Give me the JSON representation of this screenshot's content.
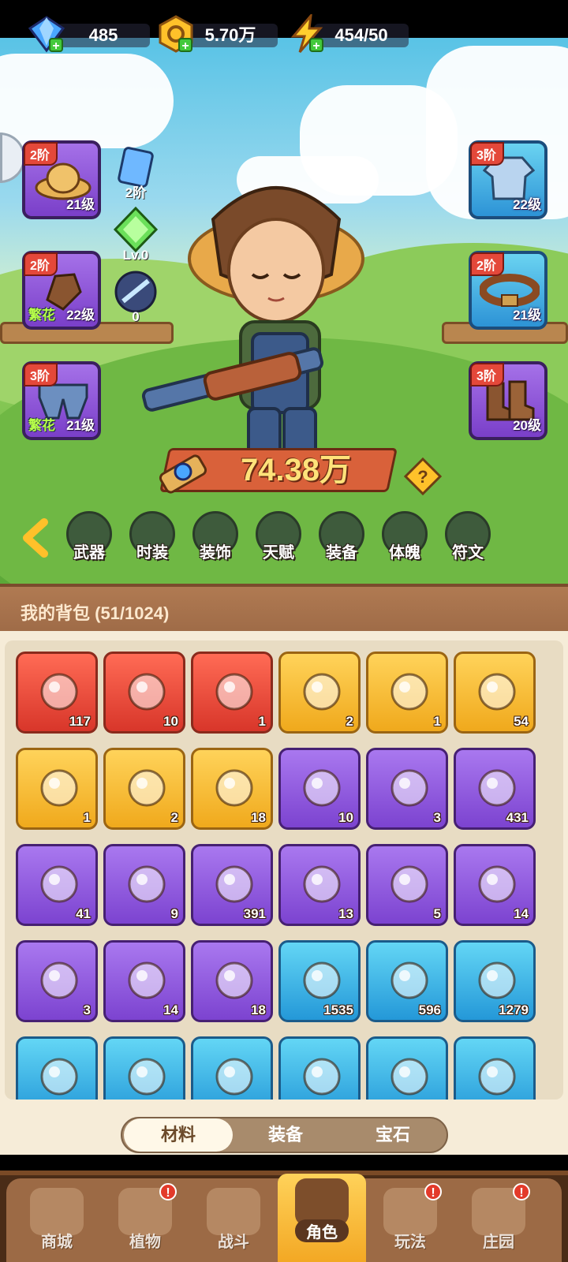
{
  "resources": {
    "gems": "485",
    "gold": "5.70万",
    "energy": "454/50"
  },
  "equip_left": [
    {
      "tier": "2阶",
      "level": "21级",
      "icon": "straw-hat-icon"
    },
    {
      "tier": "2阶",
      "level": "22级",
      "flower": "繁花",
      "icon": "glove-icon"
    },
    {
      "tier": "3阶",
      "level": "21级",
      "flower": "繁花",
      "icon": "pants-icon"
    }
  ],
  "equip_right": [
    {
      "tier": "3阶",
      "level": "22级",
      "icon": "shirt-icon"
    },
    {
      "tier": "2阶",
      "level": "21级",
      "icon": "belt-icon"
    },
    {
      "tier": "3阶",
      "level": "20级",
      "icon": "boots-icon"
    }
  ],
  "side_badges": {
    "card": "2阶",
    "gem": "Lv.0",
    "orb": "0"
  },
  "power": "74.38万",
  "menu": [
    "武器",
    "时装",
    "装饰",
    "天赋",
    "装备",
    "体魄",
    "符文"
  ],
  "bag": {
    "title": "我的背包 (51/1024)",
    "items": [
      {
        "rarity": "red",
        "count": "117",
        "icon": "crystal-star-icon"
      },
      {
        "rarity": "red",
        "count": "10",
        "icon": "red-potion-icon"
      },
      {
        "rarity": "red",
        "count": "1",
        "icon": "green-capsule-icon"
      },
      {
        "rarity": "gold",
        "count": "2",
        "icon": "golden-key-icon"
      },
      {
        "rarity": "gold",
        "count": "1",
        "icon": "rune-stone-icon"
      },
      {
        "rarity": "gold",
        "count": "54",
        "icon": "orange-potion-icon"
      },
      {
        "rarity": "gold",
        "count": "1",
        "icon": "peach-fruit-icon"
      },
      {
        "rarity": "gold",
        "count": "2",
        "icon": "flower-pot-icon"
      },
      {
        "rarity": "gold",
        "count": "18",
        "icon": "purple-book-icon"
      },
      {
        "rarity": "purple",
        "count": "10",
        "icon": "purple-bottle-icon"
      },
      {
        "rarity": "purple",
        "count": "3",
        "icon": "green-scroll-icon"
      },
      {
        "rarity": "purple",
        "count": "431",
        "icon": "purple-scroll-icon"
      },
      {
        "rarity": "purple",
        "count": "41",
        "icon": "blue-scroll-icon"
      },
      {
        "rarity": "purple",
        "count": "9",
        "icon": "red-scroll-icon"
      },
      {
        "rarity": "purple",
        "count": "391",
        "icon": "gold-scroll-icon"
      },
      {
        "rarity": "purple",
        "count": "13",
        "icon": "violet-potion-icon"
      },
      {
        "rarity": "purple",
        "count": "5",
        "icon": "blue-petal-icon"
      },
      {
        "rarity": "purple",
        "count": "14",
        "icon": "watering-can-icon"
      },
      {
        "rarity": "purple",
        "count": "3",
        "icon": "fruit-bowl-icon"
      },
      {
        "rarity": "purple",
        "count": "14",
        "icon": "golden-drop-icon"
      },
      {
        "rarity": "purple",
        "count": "18",
        "icon": "purple-crystal-icon"
      },
      {
        "rarity": "cyan",
        "count": "1535",
        "icon": "green-seed-icon"
      },
      {
        "rarity": "cyan",
        "count": "596",
        "icon": "magenta-seed-icon"
      },
      {
        "rarity": "cyan",
        "count": "1279",
        "icon": "blue-seed-icon"
      },
      {
        "rarity": "cyan",
        "count": "",
        "icon": "orange-seed-icon"
      },
      {
        "rarity": "cyan",
        "count": "",
        "icon": "yellow-seed-icon"
      },
      {
        "rarity": "cyan",
        "count": "",
        "icon": "cyan-potion-icon"
      },
      {
        "rarity": "cyan",
        "count": "",
        "icon": "garlic-icon"
      },
      {
        "rarity": "cyan",
        "count": "",
        "icon": "map-scroll-icon"
      },
      {
        "rarity": "cyan",
        "count": "",
        "icon": "map-scroll-icon"
      }
    ]
  },
  "tabs": {
    "materials": "材料",
    "equipment": "装备",
    "gems": "宝石"
  },
  "nav": [
    {
      "label": "商城",
      "icon": "shop-icon",
      "alert": ""
    },
    {
      "label": "植物",
      "icon": "plant-icon",
      "alert": "!"
    },
    {
      "label": "战斗",
      "icon": "battle-icon",
      "alert": ""
    },
    {
      "label": "角色",
      "icon": "character-icon",
      "alert": "",
      "active": true
    },
    {
      "label": "玩法",
      "icon": "gameplay-icon",
      "alert": "!"
    },
    {
      "label": "庄园",
      "icon": "manor-icon",
      "alert": "!"
    }
  ],
  "colors": {
    "red_rarity": "#d8362a",
    "gold_rarity": "#f0a91c",
    "purple_rarity": "#7c43d0",
    "cyan_rarity": "#2498d8",
    "power_banner": "#d9613a"
  }
}
